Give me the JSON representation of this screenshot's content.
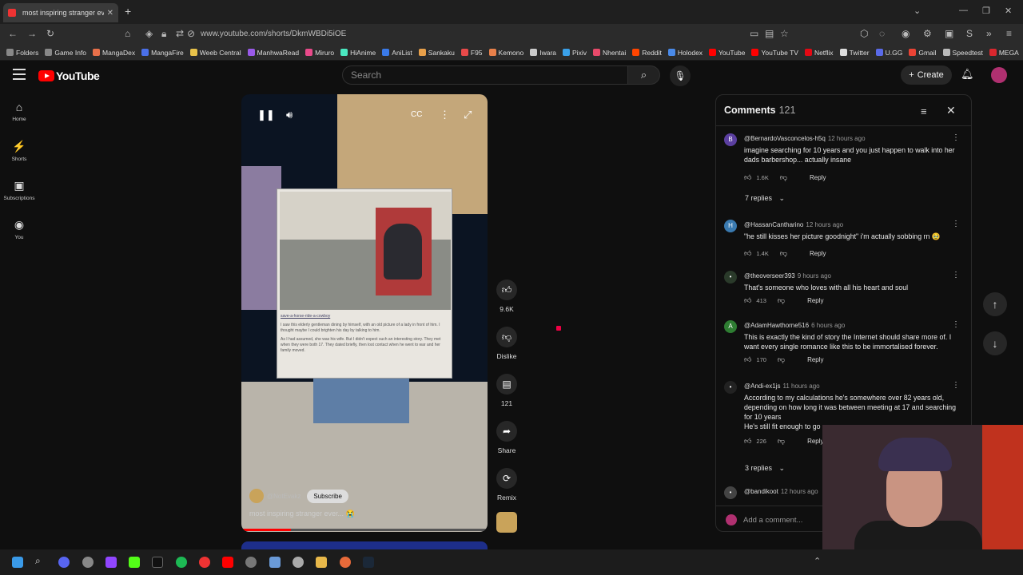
{
  "browser": {
    "tab_title": "most inspiring stranger eve...",
    "new_tab": "+",
    "url": "www.youtube.com/shorts/DkmWBDi5iOE",
    "bookmarks": [
      {
        "label": "Folders",
        "color": "#888888"
      },
      {
        "label": "Game Info",
        "color": "#888888"
      },
      {
        "label": "MangaDex",
        "color": "#e8704a"
      },
      {
        "label": "MangaFire",
        "color": "#4a6fe8"
      },
      {
        "label": "Weeb Central",
        "color": "#e8c24a"
      },
      {
        "label": "ManhwaRead",
        "color": "#9a5ae8"
      },
      {
        "label": "Miruro",
        "color": "#e84a8a"
      },
      {
        "label": "HiAnime",
        "color": "#4ae8c0"
      },
      {
        "label": "AniList",
        "color": "#3a7ae8"
      },
      {
        "label": "Sankaku",
        "color": "#e8a04a"
      },
      {
        "label": "F95",
        "color": "#e84a4a"
      },
      {
        "label": "Kemono",
        "color": "#e8804a"
      },
      {
        "label": "Iwara",
        "color": "#cccccc"
      },
      {
        "label": "Pixiv",
        "color": "#3aa0e8"
      },
      {
        "label": "Nhentai",
        "color": "#e84a6a"
      },
      {
        "label": "Reddit",
        "color": "#ff4500"
      },
      {
        "label": "Holodex",
        "color": "#4a8ae8"
      },
      {
        "label": "YouTube",
        "color": "#ff0000"
      },
      {
        "label": "YouTube TV",
        "color": "#ff0000"
      },
      {
        "label": "Netflix",
        "color": "#e50914"
      },
      {
        "label": "Twitter",
        "color": "#dddddd"
      },
      {
        "label": "U.GG",
        "color": "#5a6ae8"
      },
      {
        "label": "Gmail",
        "color": "#ea4335"
      },
      {
        "label": "Speedtest",
        "color": "#bbbbbb"
      },
      {
        "label": "MEGA",
        "color": "#d9272e"
      }
    ]
  },
  "youtube": {
    "logo_text": "YouTube",
    "search_placeholder": "Search",
    "create_label": "Create",
    "sidebar": [
      {
        "label": "Home",
        "icon": "home-icon",
        "glyph": "⌂"
      },
      {
        "label": "Shorts",
        "icon": "shorts-icon",
        "glyph": "⚡"
      },
      {
        "label": "Subscriptions",
        "icon": "subscriptions-icon",
        "glyph": "▣"
      },
      {
        "label": "You",
        "icon": "you-icon",
        "glyph": "◉"
      }
    ]
  },
  "short": {
    "channel": "@NotEvakz",
    "subscribe_label": "Subscribe",
    "title": "most inspiring stranger ever... 😭",
    "photo_caption_user": "save-a-horse-ride-a-cowboy",
    "photo_text_1": "I saw this elderly gentleman dining by himself, with an old picture of a lady in front of him. I thought maybe I could brighten his day by talking to him.",
    "photo_text_2": "As I had assumed, she was his wife. But I didn't expect such an interesting story. They met when they were both 17. They dated briefly, then lost contact when he went to war and her family moved.",
    "progress": 0.2
  },
  "actions": {
    "likes": "9.6K",
    "dislike_label": "Dislike",
    "comments_count": "121",
    "share_label": "Share",
    "remix_label": "Remix"
  },
  "comments": {
    "title": "Comments",
    "count": "121",
    "add_placeholder": "Add a comment...",
    "items": [
      {
        "user": "@BernardoVasconcelos-h5q",
        "time": "12 hours ago",
        "avatar": "B",
        "color": "#5b3fa0",
        "text": "imagine searching for 10 years and you just happen to walk into her dads barbershop... actually insane",
        "likes": "1.6K",
        "reply": "Reply",
        "replies": "7 replies"
      },
      {
        "user": "@HassanCantharino",
        "time": "12 hours ago",
        "avatar": "H",
        "color": "#3a7ab0",
        "text": "\"he still kisses her picture goodnight\" i'm actually sobbing rn 🥹",
        "likes": "1.4K",
        "reply": "Reply"
      },
      {
        "user": "@theoverseer393",
        "time": "9 hours ago",
        "avatar": "•",
        "color": "#2a3a2a",
        "text": "That's someone who loves with all his heart and soul",
        "likes": "413",
        "reply": "Reply"
      },
      {
        "user": "@AdamHawthorne516",
        "time": "6 hours ago",
        "avatar": "A",
        "color": "#2e7d32",
        "text": "This is exactly the kind of story the Internet should share more of. I want every single romance like this to be immortalised forever.",
        "likes": "170",
        "reply": "Reply"
      },
      {
        "user": "@Andi-ex1js",
        "time": "11 hours ago",
        "avatar": "•",
        "color": "#222222",
        "text": "According to my calculations he's somewhere over 82 years old, depending on how long it was between meeting at 17 and searching for 10 years\nHe's still fit enough to go",
        "likes": "226",
        "reply": "Reply",
        "replies": "3 replies"
      },
      {
        "user": "@bandikoot",
        "time": "12 hours ago",
        "avatar": "•",
        "color": "#444444",
        "text": "",
        "likes": "",
        "reply": ""
      }
    ]
  }
}
